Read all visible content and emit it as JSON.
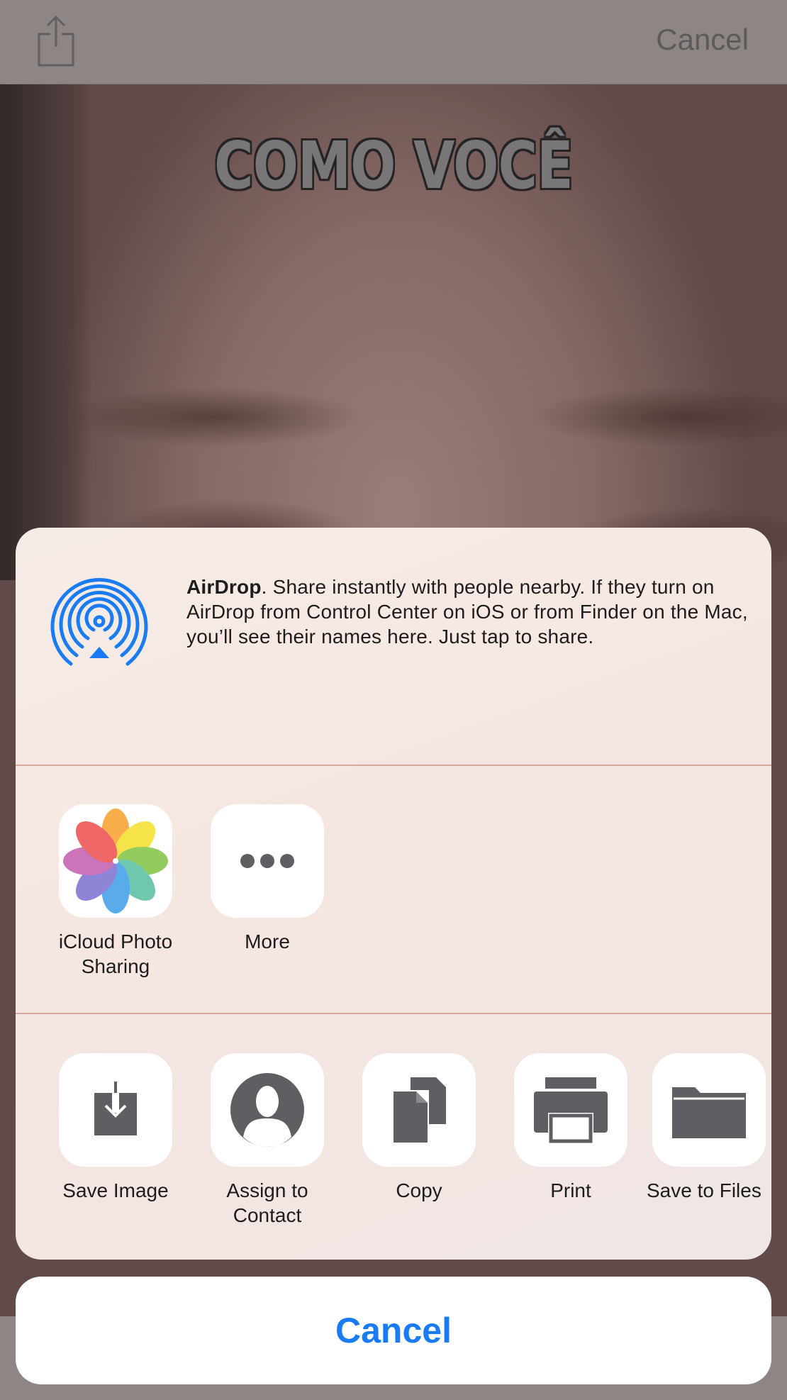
{
  "top_bar": {
    "cancel_label": "Cancel"
  },
  "meme": {
    "top_text": "COMO VOCÊ"
  },
  "airdrop": {
    "title": "AirDrop",
    "description": ". Share instantly with people nearby. If they turn on AirDrop from Control Center on iOS or from Finder on the Mac, you’ll see their names here. Just tap to share."
  },
  "share_apps": [
    {
      "label": "iCloud Photo Sharing",
      "icon": "photos-icon"
    },
    {
      "label": "More",
      "icon": "more-dots-icon"
    }
  ],
  "actions": [
    {
      "label": "Save Image",
      "icon": "save-image-icon"
    },
    {
      "label": "Assign to Contact",
      "icon": "contact-icon"
    },
    {
      "label": "Copy",
      "icon": "copy-icon"
    },
    {
      "label": "Print",
      "icon": "print-icon"
    },
    {
      "label": "Save to Files",
      "icon": "folder-icon"
    }
  ],
  "cancel_button": {
    "label": "Cancel"
  },
  "colors": {
    "accent": "#1a7cf5",
    "airdrop_blue": "#1a7cf5",
    "icon_gray": "#5f5e63"
  }
}
